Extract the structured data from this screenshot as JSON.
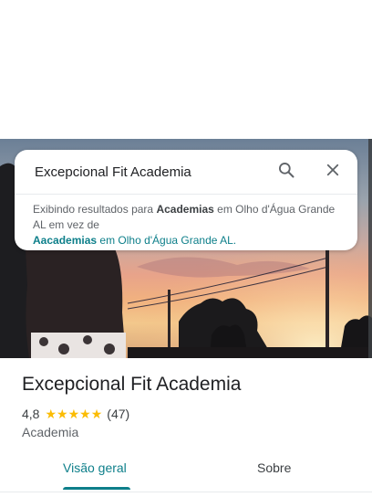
{
  "search": {
    "query": "Excepcional Fit Academia",
    "icons": {
      "search": "search-icon",
      "close": "close-icon"
    }
  },
  "suggestion": {
    "prefix": "Exibindo resultados para",
    "shown_term": "Academias",
    "shown_location": "em Olho d'Água Grande AL em vez de",
    "original_term": "Aacademias",
    "original_location": "em Olho d'Água Grande AL."
  },
  "place": {
    "name": "Excepcional Fit Academia",
    "rating": "4,8",
    "stars": [
      "★",
      "★",
      "★",
      "★",
      "★"
    ],
    "review_count": "(47)",
    "category": "Academia"
  },
  "tabs": [
    {
      "label": "Visão geral",
      "active": true
    },
    {
      "label": "Sobre",
      "active": false
    }
  ],
  "colors": {
    "accent": "#0d7f8a",
    "star": "#fbbc04",
    "text": "#202124",
    "secondary_text": "#5f6368"
  }
}
